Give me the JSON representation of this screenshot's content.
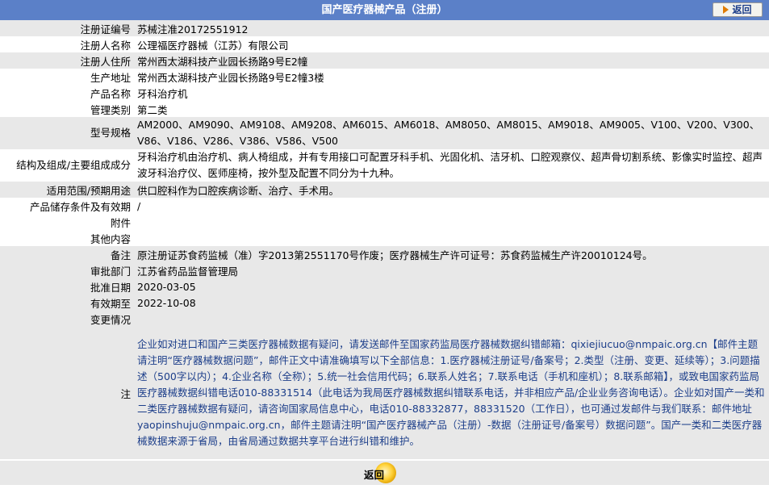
{
  "header": {
    "title": "国产医疗器械产品（注册）",
    "back_label": "返回"
  },
  "rows": [
    {
      "label": "注册证编号",
      "value": "苏械注准20172551912"
    },
    {
      "label": "注册人名称",
      "value": "公理福医疗器械（江苏）有限公司"
    },
    {
      "label": "注册人住所",
      "value": "常州西太湖科技产业园长扬路9号E2幢"
    },
    {
      "label": "生产地址",
      "value": "常州西太湖科技产业园长扬路9号E2幢3楼"
    },
    {
      "label": "产品名称",
      "value": "牙科治疗机"
    },
    {
      "label": "管理类别",
      "value": "第二类"
    },
    {
      "label": "型号规格",
      "value": "AM2000、AM9090、AM9108、AM9208、AM6015、AM6018、AM8050、AM8015、AM9018、AM9005、V100、V200、V300、V86、V186、V286、V386、V586、V500"
    },
    {
      "label": "结构及组成/主要组成成分",
      "value": "牙科治疗机由治疗机、病人椅组成，并有专用接口可配置牙科手机、光固化机、洁牙机、口腔观察仪、超声骨切割系统、影像实时监控、超声波牙科治疗仪、医师座椅，按外型及配置不同分为十九种。"
    },
    {
      "label": "适用范围/预期用途",
      "value": "供口腔科作为口腔疾病诊断、治疗、手术用。"
    },
    {
      "label": "产品储存条件及有效期",
      "value": "/"
    },
    {
      "label": "附件",
      "value": ""
    },
    {
      "label": "其他内容",
      "value": ""
    },
    {
      "label": "备注",
      "value": "原注册证苏食药监械（准）字2013第2551170号作废；医疗器械生产许可证号：苏食药监械生产许20010124号。"
    },
    {
      "label": "审批部门",
      "value": "江苏省药品监督管理局"
    },
    {
      "label": "批准日期",
      "value": "2020-03-05"
    },
    {
      "label": "有效期至",
      "value": "2022-10-08"
    },
    {
      "label": "变更情况",
      "value": ""
    }
  ],
  "note": {
    "label": "注",
    "value": "企业如对进口和国产三类医疗器械数据有疑问，请发送邮件至国家药监局医疗器械数据纠错邮箱：qixiejiucuo@nmpaic.org.cn【邮件主题请注明“医疗器械数据问题”，邮件正文中请准确填写以下全部信息：1.医疗器械注册证号/备案号；2.类型（注册、变更、延续等）；3.问题描述（500字以内）；4.企业名称（全称）；5.统一社会信用代码；6.联系人姓名；7.联系电话（手机和座机）；8.联系邮箱】，或致电国家药监局医疗器械数据纠错电话010-88331514（此电话为我局医疗器械数据纠错联系电话，并非相应产品/企业业务咨询电话）。企业如对国产一类和二类医疗器械数据有疑问，请咨询国家局信息中心，电话010-88332877，88331520（工作日），也可通过发邮件与我们联系：邮件地址yaopinshuju@nmpaic.org.cn，邮件主题请注明“国产医疗器械产品（注册）-数据（注册证号/备案号）数据问题”。国产一类和二类医疗器械数据来源于省局，由省局通过数据共享平台进行纠错和维护。"
  },
  "footer": {
    "back_label": "返回"
  }
}
